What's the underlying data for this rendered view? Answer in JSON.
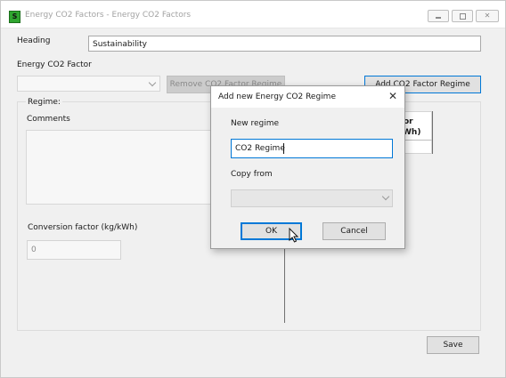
{
  "window": {
    "title": "Energy CO2 Factors - Energy CO2 Factors",
    "icon": "app-icon",
    "icon_glyph": "S",
    "minimize_icon": "minimize-icon",
    "maximize_icon": "maximize-icon",
    "close_glyph": "✕"
  },
  "form": {
    "heading_label": "Heading",
    "heading_value": "Sustainability",
    "factor_label": "Energy CO2 Factor",
    "factor_selected": "",
    "remove_button": "Remove CO2 Factor Regime",
    "add_button": "Add CO2 Factor Regime",
    "regime_label": "Regime:",
    "comments_label": "Comments",
    "comments_value": "",
    "conversion_label": "Conversion factor (kg/kWh)",
    "conversion_value": "0",
    "table_header_line1": "or",
    "table_header_line2": "Wh)",
    "save_button": "Save"
  },
  "dialog": {
    "title": "Add new Energy CO2 Regime",
    "close_glyph": "✕",
    "new_regime_label": "New regime",
    "new_regime_value": "CO2 Regime",
    "copy_from_label": "Copy from",
    "copy_from_selected": "",
    "ok_button": "OK",
    "cancel_button": "Cancel"
  },
  "colors": {
    "accent": "#0078d7",
    "window_bg": "#f0f0f0",
    "icon_green": "#2fa52f"
  }
}
